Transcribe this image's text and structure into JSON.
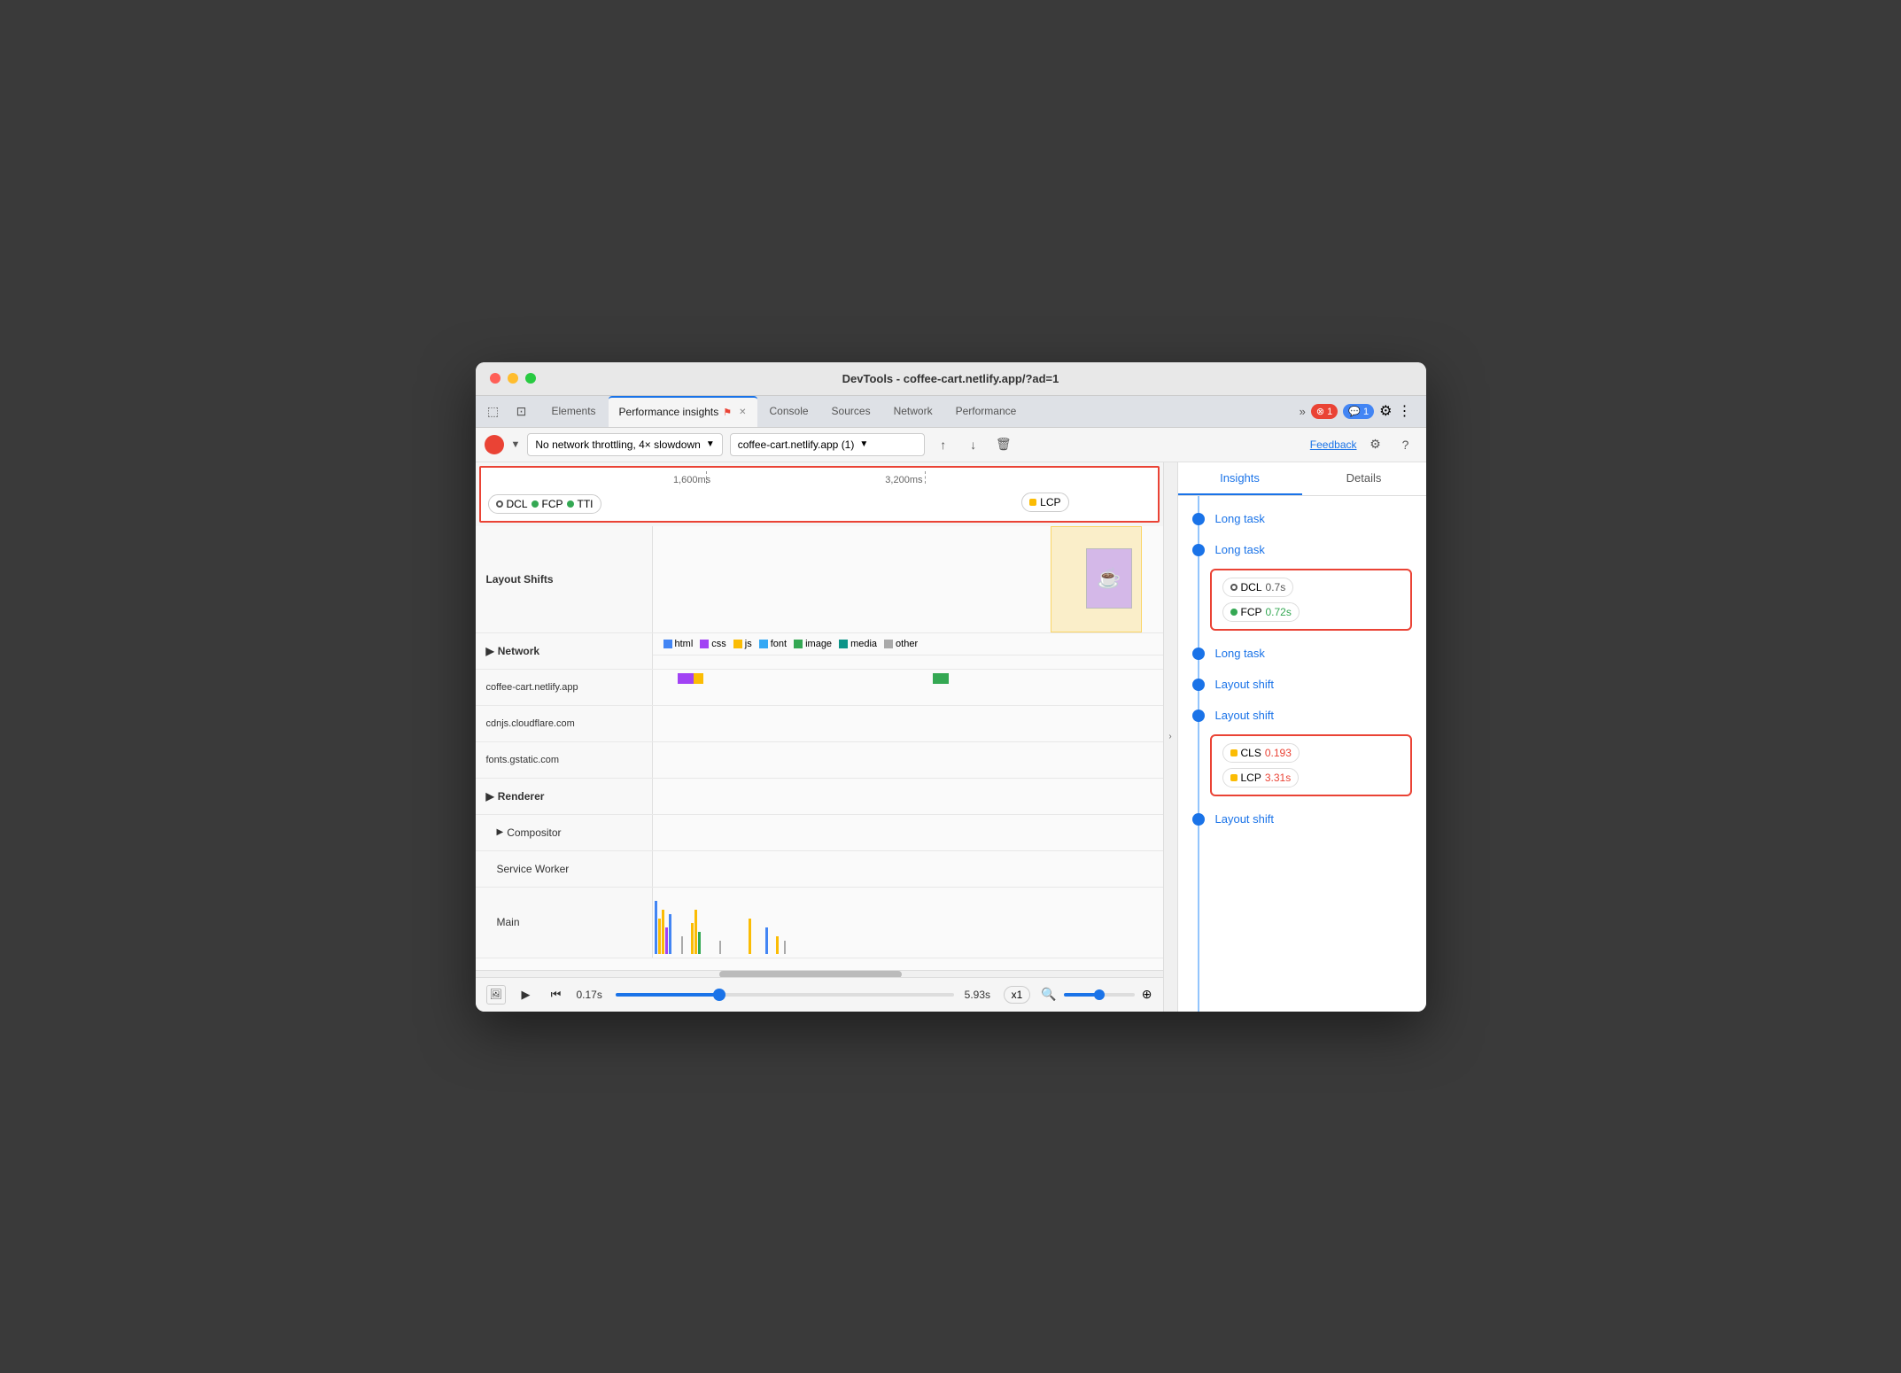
{
  "window": {
    "title": "DevTools - coffee-cart.netlify.app/?ad=1"
  },
  "tabs": [
    {
      "id": "elements",
      "label": "Elements",
      "active": false
    },
    {
      "id": "performance-insights",
      "label": "Performance insights",
      "active": true,
      "has_close": true,
      "has_icon": true
    },
    {
      "id": "console",
      "label": "Console",
      "active": false
    },
    {
      "id": "sources",
      "label": "Sources",
      "active": false
    },
    {
      "id": "network",
      "label": "Network",
      "active": false
    },
    {
      "id": "performance",
      "label": "Performance",
      "active": false
    }
  ],
  "toolbar": {
    "record_btn": "record",
    "throttle_label": "No network throttling, 4× slowdown",
    "url_label": "coffee-cart.netlify.app (1)",
    "feedback_label": "Feedback"
  },
  "timeline": {
    "marker_1600": "1,600ms",
    "marker_3200": "3,200ms",
    "dcl_label": "DCL",
    "fcp_label": "FCP",
    "tti_label": "TTI",
    "lcp_label": "LCP"
  },
  "tracks": {
    "layout_shifts": "Layout Shifts",
    "network": "Network",
    "network_urls": [
      "coffee-cart.netlify.app",
      "cdnjs.cloudflare.com",
      "fonts.gstatic.com"
    ],
    "network_legend": [
      "html",
      "css",
      "js",
      "font",
      "image",
      "media",
      "other"
    ],
    "renderer": "Renderer",
    "compositor": "Compositor",
    "service_worker": "Service Worker",
    "main": "Main"
  },
  "playback": {
    "time_start": "0.17s",
    "time_end": "5.93s",
    "speed": "x1"
  },
  "insights": {
    "tab_insights": "Insights",
    "tab_details": "Details",
    "items": [
      {
        "type": "link",
        "label": "Long task"
      },
      {
        "type": "link",
        "label": "Long task"
      },
      {
        "type": "metric",
        "id": "dcl",
        "label": "DCL",
        "value": "0.7s",
        "color": "normal"
      },
      {
        "type": "metric",
        "id": "fcp",
        "label": "FCP",
        "value": "0.72s",
        "color": "green"
      },
      {
        "type": "link",
        "label": "Long task"
      },
      {
        "type": "link",
        "label": "Layout shift"
      },
      {
        "type": "link",
        "label": "Layout shift"
      },
      {
        "type": "metric",
        "id": "cls",
        "label": "CLS",
        "value": "0.193",
        "color": "orange"
      },
      {
        "type": "metric",
        "id": "lcp",
        "label": "LCP",
        "value": "3.31s",
        "color": "orange"
      },
      {
        "type": "link",
        "label": "Layout shift"
      }
    ]
  }
}
